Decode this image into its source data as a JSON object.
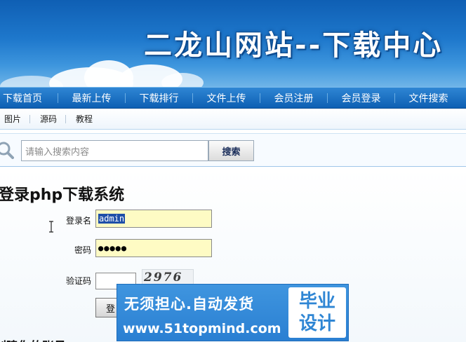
{
  "banner": {
    "title": "二龙山网站--下载中心"
  },
  "nav": {
    "items": [
      {
        "label": "下载首页"
      },
      {
        "label": "最新上传"
      },
      {
        "label": "下载排行"
      },
      {
        "label": "文件上传"
      },
      {
        "label": "会员注册"
      },
      {
        "label": "会员登录"
      },
      {
        "label": "文件搜索"
      }
    ]
  },
  "subnav": {
    "items": [
      {
        "label": "图片"
      },
      {
        "label": "源码"
      },
      {
        "label": "教程"
      }
    ]
  },
  "search": {
    "placeholder": "请输入搜索内容",
    "button_label": "搜索"
  },
  "login": {
    "title": "登录php下载系统",
    "username_label": "登录名",
    "username_value": "admin",
    "password_label": "密码",
    "password_value": "●●●●●",
    "captcha_label": "验证码",
    "captcha_image_text": "2976",
    "submit_label": "登",
    "register_text": "创建你的账号"
  },
  "ad": {
    "line1": "无须担心.自动发货",
    "line2": "www.51topmind.com",
    "badge_line1": "毕业",
    "badge_line2": "设计"
  },
  "colors": {
    "nav_bg": "#0d5fb3",
    "banner_bg": "#1e78cc",
    "input_highlight": "#fefbc4",
    "ad_bg": "#2f86d4"
  }
}
